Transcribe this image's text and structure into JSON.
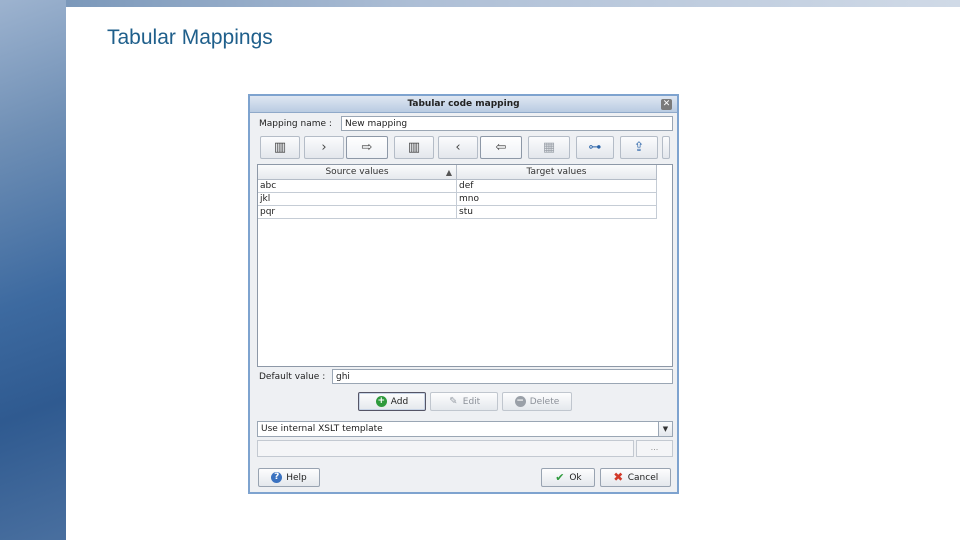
{
  "slide": {
    "title": "Tabular Mappings"
  },
  "dialog": {
    "title": "Tabular code mapping",
    "close_glyph": "✕",
    "mapping_name_label": "Mapping name :",
    "mapping_name_value": "New mapping",
    "toolbar": [
      {
        "icon": "source-table-icon",
        "glyph": "▥"
      },
      {
        "icon": "move-right-icon",
        "glyph": "›"
      },
      {
        "icon": "map-right-icon",
        "glyph": "⇨"
      },
      {
        "icon": "target-table-icon",
        "glyph": "▥"
      },
      {
        "icon": "move-left-icon",
        "glyph": "‹"
      },
      {
        "icon": "map-left-icon",
        "glyph": "⇦"
      },
      {
        "icon": "grid-icon",
        "glyph": "▦"
      },
      {
        "icon": "tree-icon",
        "glyph": "⊶"
      },
      {
        "icon": "export-icon",
        "glyph": "⇪"
      }
    ],
    "table": {
      "columns": [
        "Source values",
        "Target values"
      ],
      "sort_glyph": "▲",
      "rows": [
        [
          "abc",
          "def"
        ],
        [
          "jkl",
          "mno"
        ],
        [
          "pqr",
          "stu"
        ]
      ]
    },
    "default_value_label": "Default value :",
    "default_value": "ghi",
    "buttons": {
      "add": "Add",
      "edit": "Edit",
      "delete": "Delete"
    },
    "template_select": "Use internal XSLT template",
    "dots": "...",
    "help": "Help",
    "ok": "Ok",
    "cancel": "Cancel"
  },
  "colors": {
    "title_text": "#1f5f8b",
    "dialog_border": "#7ea3cf",
    "add_icon": "#2e9a3c",
    "cancel_icon": "#d23a2a",
    "help_icon": "#3a72c0"
  }
}
